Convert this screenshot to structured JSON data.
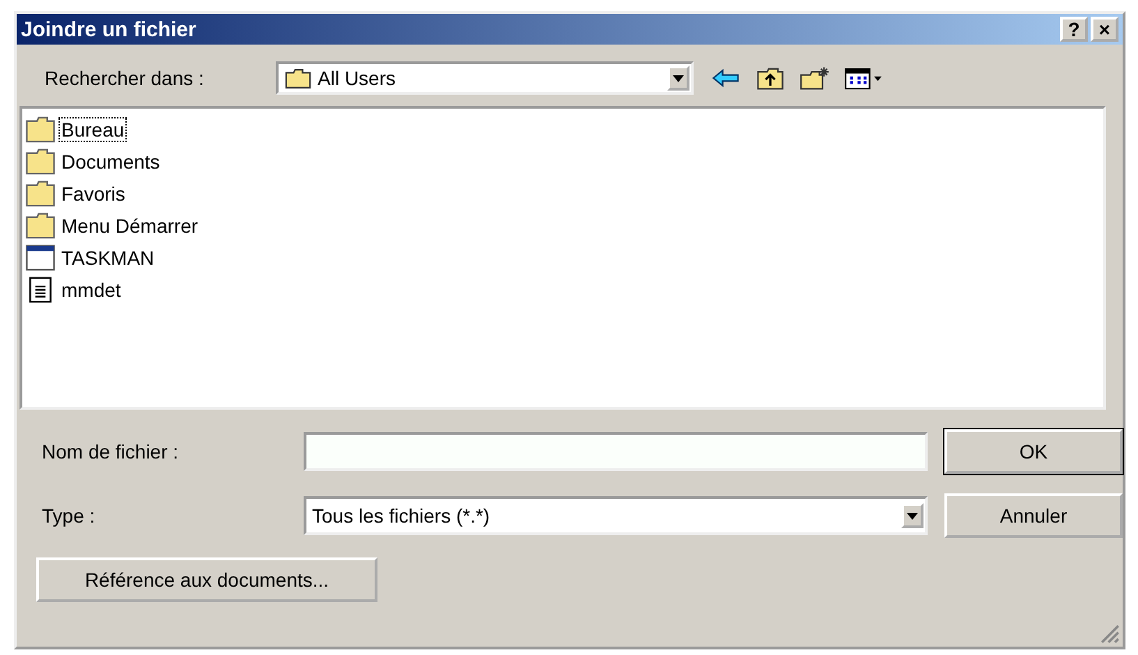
{
  "window": {
    "title": "Joindre un fichier",
    "help": "?",
    "close": "×"
  },
  "look_in": {
    "label": "Rechercher dans :",
    "value": "All Users"
  },
  "files": [
    {
      "name": "Bureau",
      "kind": "folder",
      "selected": true
    },
    {
      "name": "Documents",
      "kind": "folder",
      "selected": false
    },
    {
      "name": "Favoris",
      "kind": "folder",
      "selected": false
    },
    {
      "name": "Menu Démarrer",
      "kind": "folder",
      "selected": false
    },
    {
      "name": "TASKMAN",
      "kind": "app",
      "selected": false
    },
    {
      "name": "mmdet",
      "kind": "text",
      "selected": false
    }
  ],
  "filename": {
    "label": "Nom de fichier :"
  },
  "type": {
    "label": "Type :",
    "value": "Tous les fichiers (*.*)"
  },
  "buttons": {
    "ok": "OK",
    "cancel": "Annuler",
    "reference": "Référence aux documents..."
  }
}
